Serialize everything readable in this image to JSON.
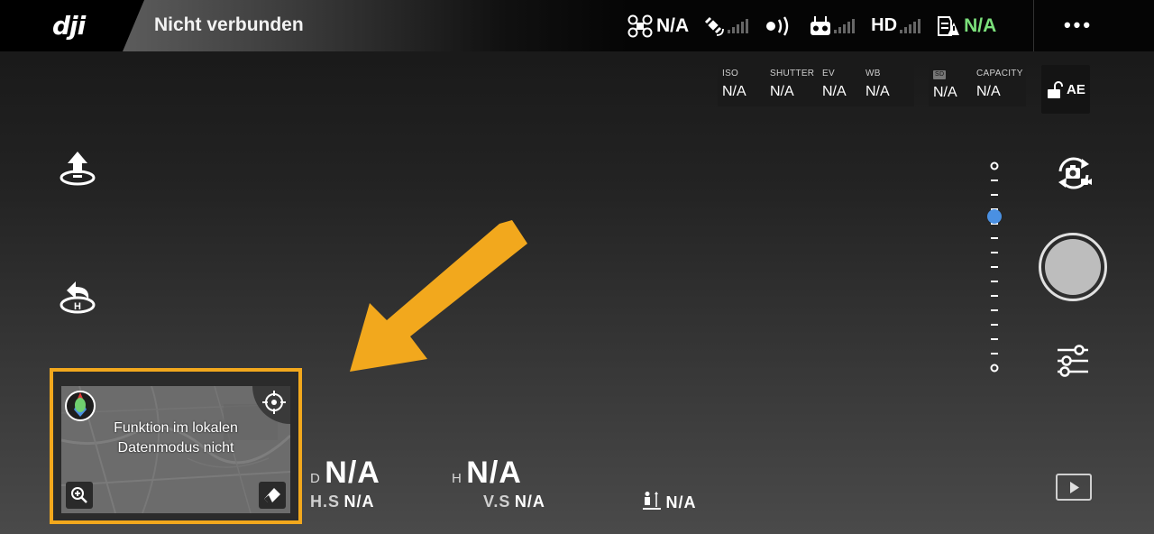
{
  "topbar": {
    "brand": "dji",
    "connection_status": "Nicht verbunden",
    "aircraft_status": "N/A",
    "battery_status": "N/A",
    "hd_label": "HD",
    "more_label": "•••"
  },
  "camera": {
    "iso_label": "ISO",
    "iso_value": "N/A",
    "shutter_label": "SHUTTER",
    "shutter_value": "N/A",
    "ev_label": "EV",
    "ev_value": "N/A",
    "wb_label": "WB",
    "wb_value": "N/A",
    "sd_label": "SD",
    "sd_value": "N/A",
    "capacity_label": "CAPACITY",
    "capacity_value": "N/A",
    "ae_label": "AE"
  },
  "map": {
    "message_line1": "Funktion im lokalen",
    "message_line2": "Datenmodus nicht"
  },
  "telemetry": {
    "d_label": "D",
    "d_value": "N/A",
    "h_label": "H",
    "h_value": "N/A",
    "hs_label": "H.S",
    "hs_value": "N/A",
    "vs_label": "V.S",
    "vs_value": "N/A",
    "vps_value": "N/A"
  },
  "colors": {
    "highlight_border": "#f2a81d",
    "arrow": "#f2a81d",
    "status_green": "#7be07b",
    "zoom_thumb": "#4a90e2"
  },
  "zoom": {
    "level": 0.25
  }
}
